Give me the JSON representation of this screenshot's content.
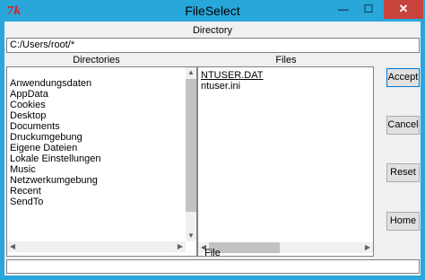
{
  "window": {
    "title": "FileSelect",
    "app_icon_text": "7k",
    "min_label": "—",
    "max_label": "☐",
    "close_label": "✕"
  },
  "directory": {
    "label": "Directory",
    "value": "C:/Users/root/*"
  },
  "directories": {
    "label": "Directories",
    "items": [
      "Anwendungsdaten",
      "AppData",
      "Cookies",
      "Desktop",
      "Documents",
      "Druckumgebung",
      "Eigene Dateien",
      "Lokale Einstellungen",
      "Music",
      "Netzwerkumgebung",
      "Recent",
      "SendTo"
    ]
  },
  "files": {
    "label": "Files",
    "items": [
      "NTUSER.DAT",
      "ntuser.ini"
    ],
    "selected": "NTUSER.DAT"
  },
  "buttons": {
    "accept": "Accept",
    "cancel": "Cancel",
    "reset": "Reset",
    "home": "Home"
  },
  "file": {
    "label": "File",
    "value": ""
  },
  "icons": {
    "up": "▲",
    "down": "▼",
    "left": "◀",
    "right": "▶"
  }
}
